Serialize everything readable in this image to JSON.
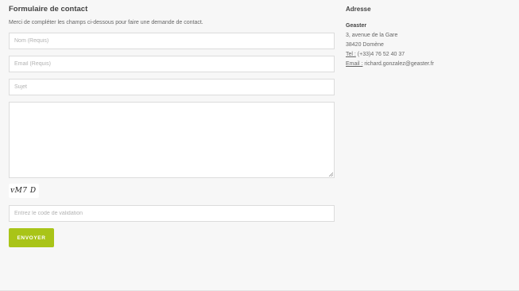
{
  "form": {
    "title": "Formulaire de contact",
    "intro": "Merci de compléter les champs ci-dessous pour faire une demande de contact.",
    "name_placeholder": "Nom (Requis)",
    "email_placeholder": "Email (Requis)",
    "subject_placeholder": "Sujet",
    "message_value": "",
    "captcha_text": "ᴠM7 D",
    "code_placeholder": "Entrez le code de validation",
    "submit_label": "ENVOYER"
  },
  "address": {
    "title": "Adresse",
    "company": "Geaster",
    "street": "3, avenue de la Gare",
    "city": "38420 Domène",
    "phone_label": "Tel :",
    "phone_value": " (+33)4 76 52 40 37",
    "email_label": "Email :",
    "email_value": " richard.gonzalez@geaster.fr"
  },
  "colors": {
    "background": "#f7f7f7",
    "accent": "#a9c418",
    "field_border": "#dcdcdc"
  }
}
